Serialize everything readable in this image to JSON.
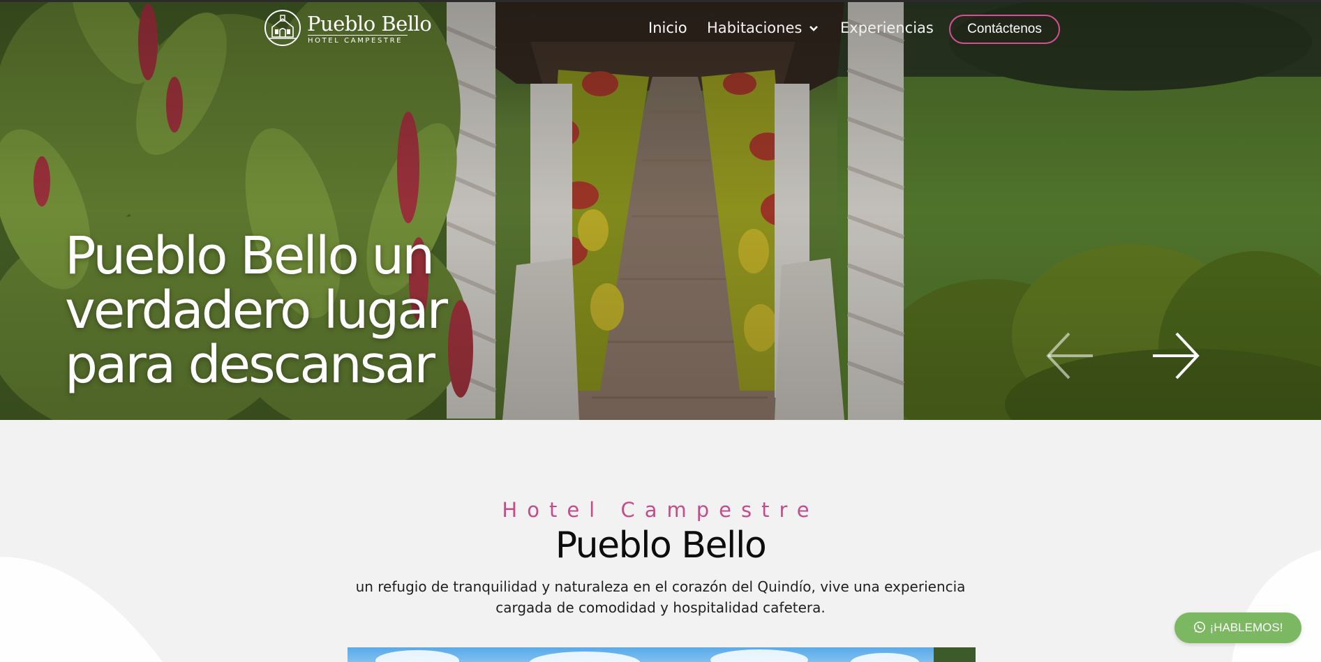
{
  "brand": {
    "title": "Pueblo Bello",
    "subtitle": "HOTEL CAMPESTRE"
  },
  "nav": {
    "items": [
      {
        "label": "Inicio"
      },
      {
        "label": "Habitaciones"
      },
      {
        "label": "Experiencias"
      }
    ],
    "contact_label": "Contáctenos"
  },
  "hero": {
    "headline": [
      "Pueblo Bello un",
      "verdadero lugar",
      "para descansar"
    ]
  },
  "intro": {
    "kicker": "Hotel Campestre",
    "title": "Pueblo Bello",
    "text": "un refugio de tranquilidad y naturaleza en el corazón del Quindío, vive una experiencia cargada de comodidad y hospitalidad cafetera."
  },
  "whatsapp": {
    "label": "¡HABLEMOS!"
  },
  "colors": {
    "accent": "#c24d8a",
    "button_border": "#d64f92",
    "whatsapp": "#7cb861"
  },
  "icons": [
    "hotel-logo-icon",
    "chevron-down-icon",
    "arrow-left-icon",
    "arrow-right-icon",
    "whatsapp-icon"
  ]
}
